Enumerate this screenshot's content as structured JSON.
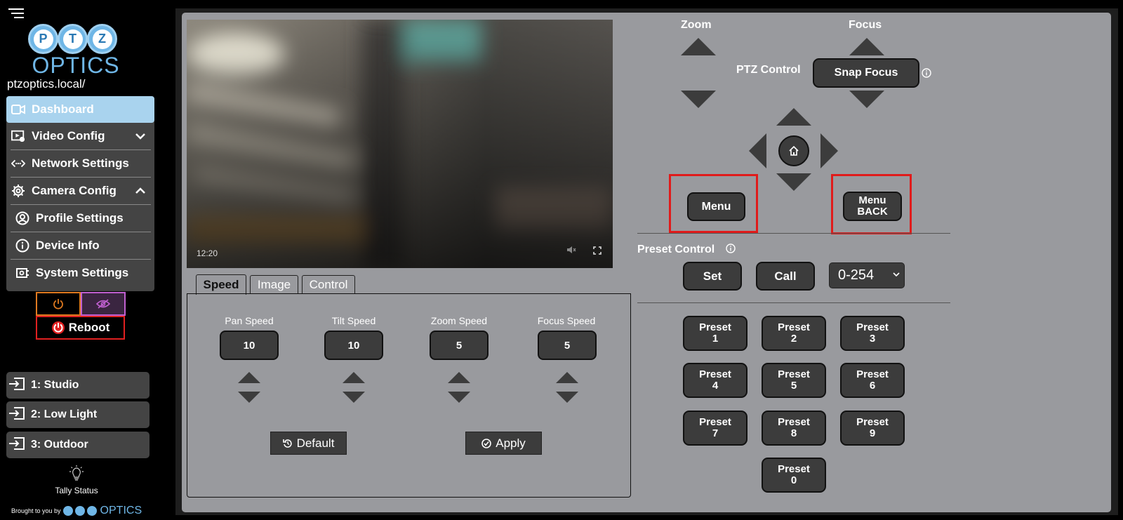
{
  "app": {
    "hostname": "ptzoptics.local/",
    "logo_letters": [
      "P",
      "T",
      "Z"
    ],
    "logo_word": "OPTICS"
  },
  "nav": {
    "items": [
      {
        "label": "Dashboard",
        "icon": "video-camera-icon",
        "active": true
      },
      {
        "label": "Video Config",
        "icon": "video-config-icon",
        "expanded": false
      },
      {
        "label": "Network Settings",
        "icon": "network-icon"
      },
      {
        "label": "Camera Config",
        "icon": "gear-icon",
        "expanded": true
      },
      {
        "label": "Profile Settings",
        "icon": "user-circle-icon"
      },
      {
        "label": "Device Info",
        "icon": "info-icon"
      },
      {
        "label": "System Settings",
        "icon": "system-icon"
      }
    ]
  },
  "power": {
    "reboot_label": "Reboot"
  },
  "scenes": [
    {
      "label": "1: Studio"
    },
    {
      "label": "2: Low Light"
    },
    {
      "label": "3: Outdoor"
    }
  ],
  "tally": {
    "label": "Tally Status"
  },
  "footer": {
    "brought_by": "Brought to you by",
    "brand": "OPTICS"
  },
  "video": {
    "timestamp": "12:20"
  },
  "tabs": [
    {
      "label": "Speed",
      "active": true
    },
    {
      "label": "Image"
    },
    {
      "label": "Control"
    }
  ],
  "speed": {
    "controls": [
      {
        "label": "Pan Speed",
        "value": "10"
      },
      {
        "label": "Tilt Speed",
        "value": "10"
      },
      {
        "label": "Zoom Speed",
        "value": "5"
      },
      {
        "label": "Focus Speed",
        "value": "5"
      }
    ],
    "default_label": "Default",
    "apply_label": "Apply"
  },
  "ptz": {
    "zoom_label": "Zoom",
    "focus_label": "Focus",
    "ptz_control_label": "PTZ Control",
    "snap_focus_label": "Snap Focus",
    "menu_label": "Menu",
    "menu_back_line1": "Menu",
    "menu_back_line2": "BACK"
  },
  "preset": {
    "title": "Preset Control",
    "set_label": "Set",
    "call_label": "Call",
    "range_value": "0-254",
    "buttons": [
      {
        "label": "Preset",
        "num": "1"
      },
      {
        "label": "Preset",
        "num": "2"
      },
      {
        "label": "Preset",
        "num": "3"
      },
      {
        "label": "Preset",
        "num": "4"
      },
      {
        "label": "Preset",
        "num": "5"
      },
      {
        "label": "Preset",
        "num": "6"
      },
      {
        "label": "Preset",
        "num": "7"
      },
      {
        "label": "Preset",
        "num": "8"
      },
      {
        "label": "Preset",
        "num": "9"
      },
      {
        "label": "Preset",
        "num": "0"
      }
    ]
  },
  "colors": {
    "accent": "#a9d3ee",
    "panel": "#999a9e",
    "button": "#3c3c3c",
    "highlight": "#e01b1b"
  }
}
